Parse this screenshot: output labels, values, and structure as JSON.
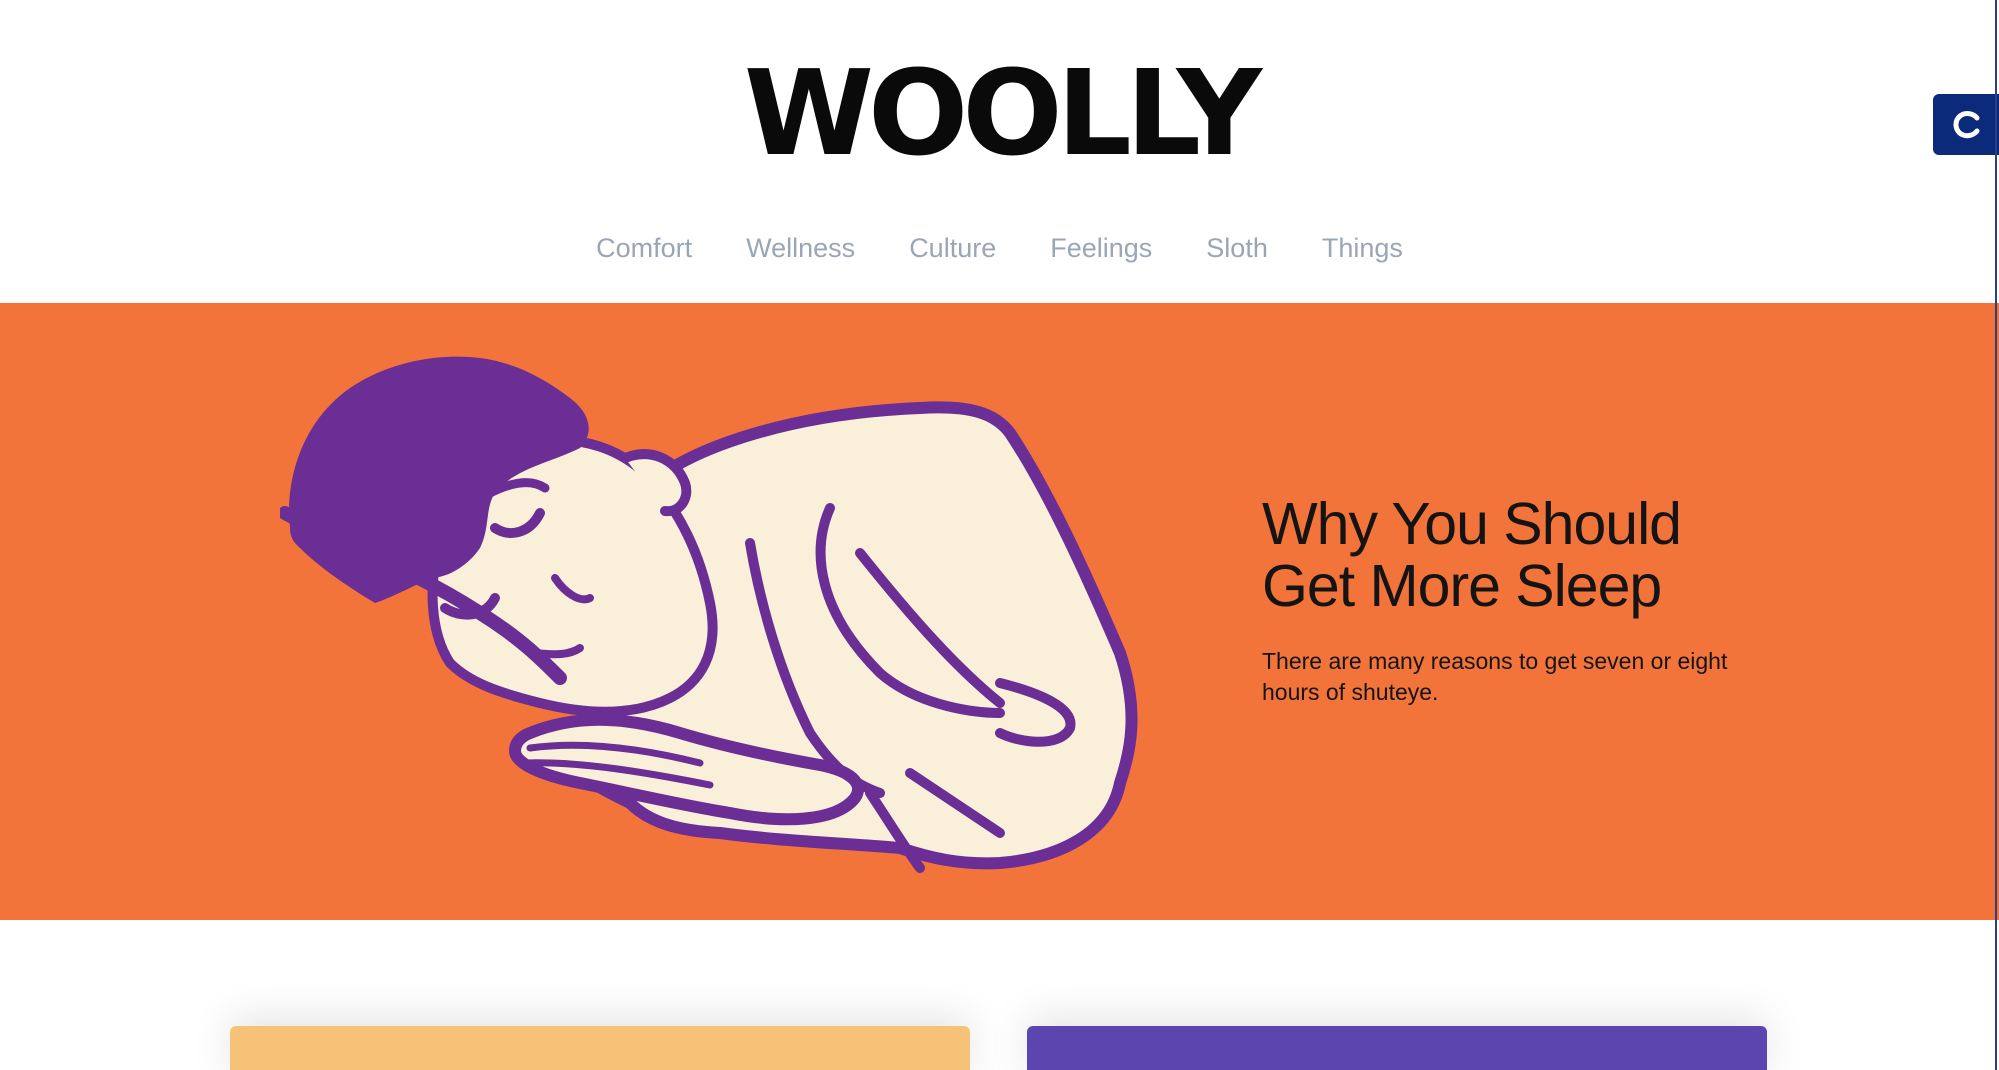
{
  "site": {
    "logo_text": "WOOLLY",
    "logo_color": "#0a0a0a"
  },
  "nav": {
    "items": [
      "Comfort",
      "Wellness",
      "Culture",
      "Feelings",
      "Sloth",
      "Things"
    ],
    "color": "#9aa6b6"
  },
  "hero": {
    "title_line1": "Why You Should",
    "title_line2": "Get More Sleep",
    "description": "There are many reasons to get seven or eight hours of shuteye.",
    "background_color": "#f3743b",
    "illustration": "sleeping-person-illustration",
    "illustration_colors": {
      "outline": "#6a2e95",
      "fill": "#faf0da"
    }
  },
  "cards": [
    {
      "color": "#f6c277"
    },
    {
      "color": "#5b46b0"
    }
  ],
  "side_badge": {
    "icon": "c-logo-icon",
    "color": "#0b2a7a"
  }
}
